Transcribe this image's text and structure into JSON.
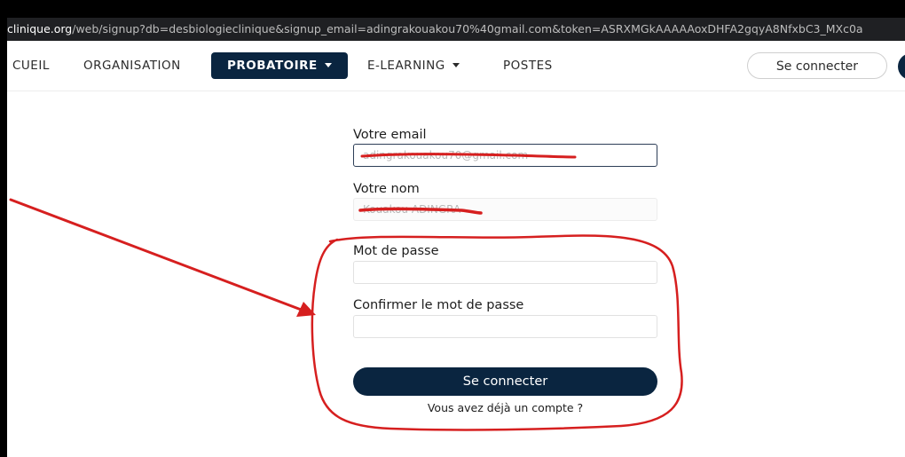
{
  "browser": {
    "url_host": "clinique.org",
    "url_path": "/web/signup?db=desbiologieclinique&signup_email=adingrakouakou70%40gmail.com&token=ASRXMGkAAAAAoxDHFA2gqyA8NfxbC3_MXc0a"
  },
  "nav": {
    "items": [
      {
        "label": "CUEIL"
      },
      {
        "label": "ORGANISATION"
      },
      {
        "label": "PROBATOIRE"
      },
      {
        "label": "E-LEARNING"
      },
      {
        "label": "POSTES"
      }
    ],
    "login_label": "Se connecter"
  },
  "form": {
    "email_label": "Votre email",
    "email_value": "adingrakouakou70@gmail.com",
    "name_label": "Votre nom",
    "name_value": "Kouakou ADINGRA",
    "password_label": "Mot de passe",
    "confirm_label": "Confirmer le mot de passe",
    "submit_label": "Se connecter",
    "have_account_link": "Vous avez déjà un compte ?"
  },
  "colors": {
    "brand_dark": "#0a2540",
    "annotation_red": "#d61f1f"
  }
}
